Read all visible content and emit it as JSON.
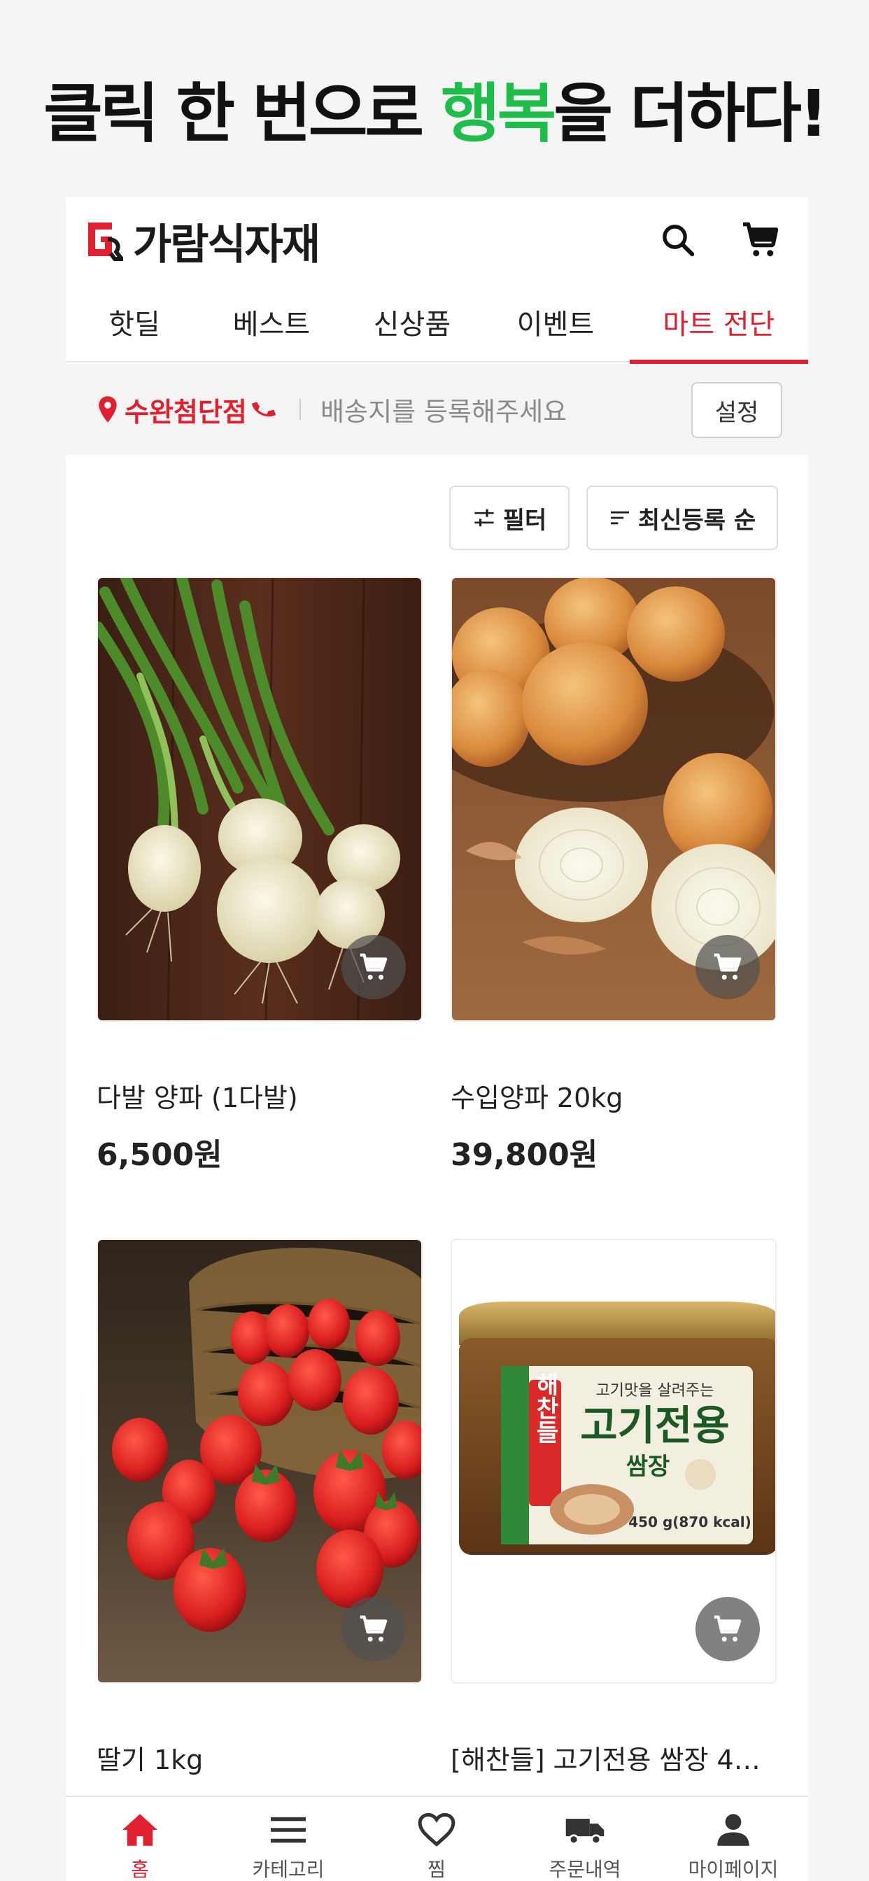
{
  "headline": {
    "part1": "클릭 한 번으로 ",
    "highlight": "행복",
    "part2": "을 더하다!"
  },
  "header": {
    "brand": "가람식자재",
    "search_icon": "search-icon",
    "cart_icon": "cart-icon"
  },
  "tabs": [
    {
      "label": "핫딜"
    },
    {
      "label": "베스트"
    },
    {
      "label": "신상품"
    },
    {
      "label": "이벤트"
    },
    {
      "label": "마트 전단",
      "active": true
    }
  ],
  "store": {
    "name": "수완첨단점",
    "address_placeholder": "배송지를 등록해주세요",
    "settings_label": "설정"
  },
  "filters": {
    "filter_label": "필터",
    "sort_label": "최신등록 순"
  },
  "products": [
    {
      "name": "다발 양파 (1다발)",
      "price": "6,500원",
      "image": "green-onion-bunch"
    },
    {
      "name": "수입양파 20kg",
      "price": "39,800원",
      "image": "onions"
    },
    {
      "name": "딸기 1kg",
      "price": "",
      "image": "strawberries"
    },
    {
      "name": "[해찬들] 고기전용 쌈장 45…",
      "price": "",
      "image": "ssamjang-tub",
      "package_text": {
        "brand": "해찬들",
        "tagline": "고기맛을 살려주는",
        "title": "고기전용",
        "subtitle": "쌈장",
        "weight": "450 g(870 kcal)"
      }
    }
  ],
  "bottom_nav": [
    {
      "label": "홈",
      "icon": "home-icon",
      "active": true
    },
    {
      "label": "카테고리",
      "icon": "menu-icon"
    },
    {
      "label": "찜",
      "icon": "heart-icon"
    },
    {
      "label": "주문내역",
      "icon": "truck-icon"
    },
    {
      "label": "마이페이지",
      "icon": "user-icon"
    }
  ],
  "colors": {
    "accent": "#e0202f",
    "highlight": "#1fbd4a"
  }
}
